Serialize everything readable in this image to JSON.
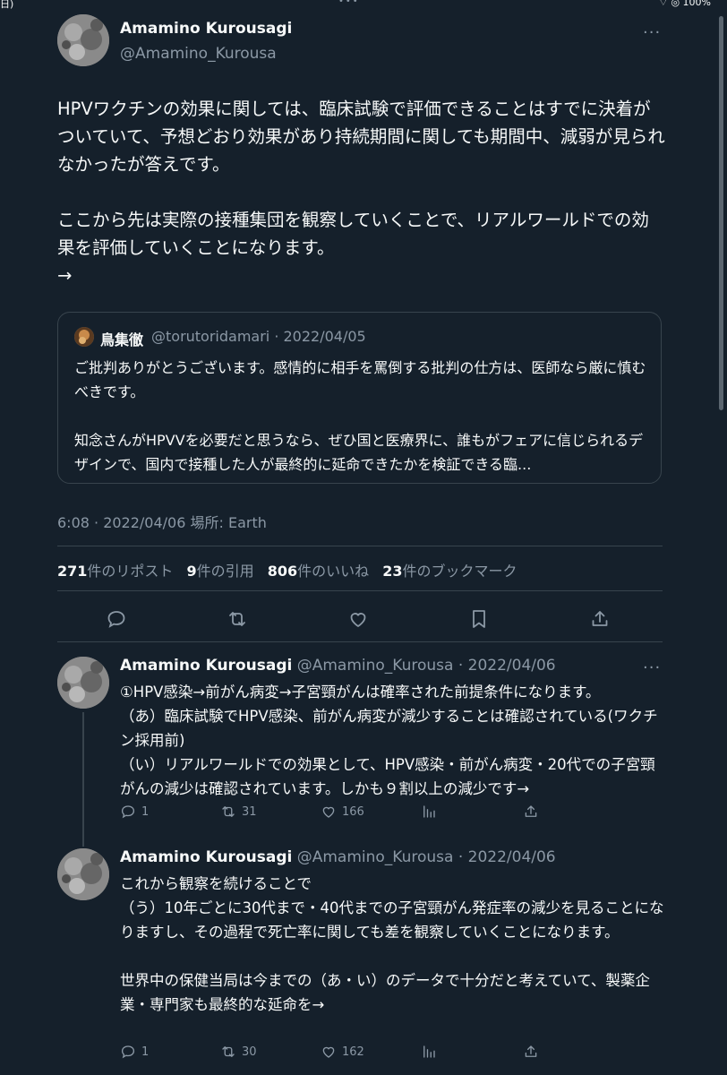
{
  "status_bar": {
    "left": "日)",
    "dots": "•••",
    "right": "100%"
  },
  "main_tweet": {
    "name": "Amamino Kurousagi",
    "handle": "@Amamino_Kurousa",
    "text": "HPVワクチンの効果に関しては、臨床試験で評価できることはすでに決着がついていて、予想どおり効果があり持続期間に関しても期間中、減弱が見られなかったが答えです。\n\nここから先は実際の接種集団を観察していくことで、リアルワールドでの効果を評価していくことになります。\n→",
    "quote": {
      "name": "鳥集徹",
      "meta": "@torutoridamari · 2022/04/05",
      "text": "ご批判ありがとうございます。感情的に相手を罵倒する批判の仕方は、医師なら厳に慎むべきです。\n\n知念さんがHPVVを必要だと思うなら、ぜひ国と医療界に、誰もがフェアに信じられるデザインで、国内で接種した人が最終的に延命できたかを検証できる臨..."
    },
    "timestamp": "6:08 · 2022/04/06 場所: Earth",
    "stats": {
      "reposts_count": "271",
      "reposts_label": "件のリポスト",
      "quotes_count": "9",
      "quotes_label": "件の引用",
      "likes_count": "806",
      "likes_label": "件のいいね",
      "bookmarks_count": "23",
      "bookmarks_label": "件のブックマーク"
    }
  },
  "replies": [
    {
      "name": "Amamino Kurousagi",
      "meta": "@Amamino_Kurousa · 2022/04/06",
      "text": "①HPV感染→前がん病変→子宮頸がんは確率された前提条件になります。\n（あ）臨床試験でHPV感染、前がん病変が減少することは確認されている(ワクチン採用前)\n（い）リアルワールドでの効果として、HPV感染・前がん病変・20代での子宮頸がんの減少は確認されています。しかも９割以上の減少です→",
      "replies": "1",
      "reposts": "31",
      "likes": "166"
    },
    {
      "name": "Amamino Kurousagi",
      "meta": "@Amamino_Kurousa · 2022/04/06",
      "text": "これから観察を続けることで\n（う）10年ごとに30代まで・40代までの子宮頸がん発症率の減少を見ることになりますし、その過程で死亡率に関しても差を観察していくことになります。\n\n世界中の保健当局は今までの（あ・い）のデータで十分だと考えていて、製薬企業・専門家も最終的な延命を→",
      "replies": "1",
      "reposts": "30",
      "likes": "162"
    }
  ],
  "icons": [
    "more-icon",
    "reply-icon",
    "repost-icon",
    "like-icon",
    "bookmark-icon",
    "share-icon",
    "views-icon",
    "wifi-icon",
    "battery-icon"
  ],
  "colors": {
    "background": "#15202b",
    "text": "#f7f9f9",
    "secondary": "#8b98a5",
    "border": "#38444d"
  }
}
